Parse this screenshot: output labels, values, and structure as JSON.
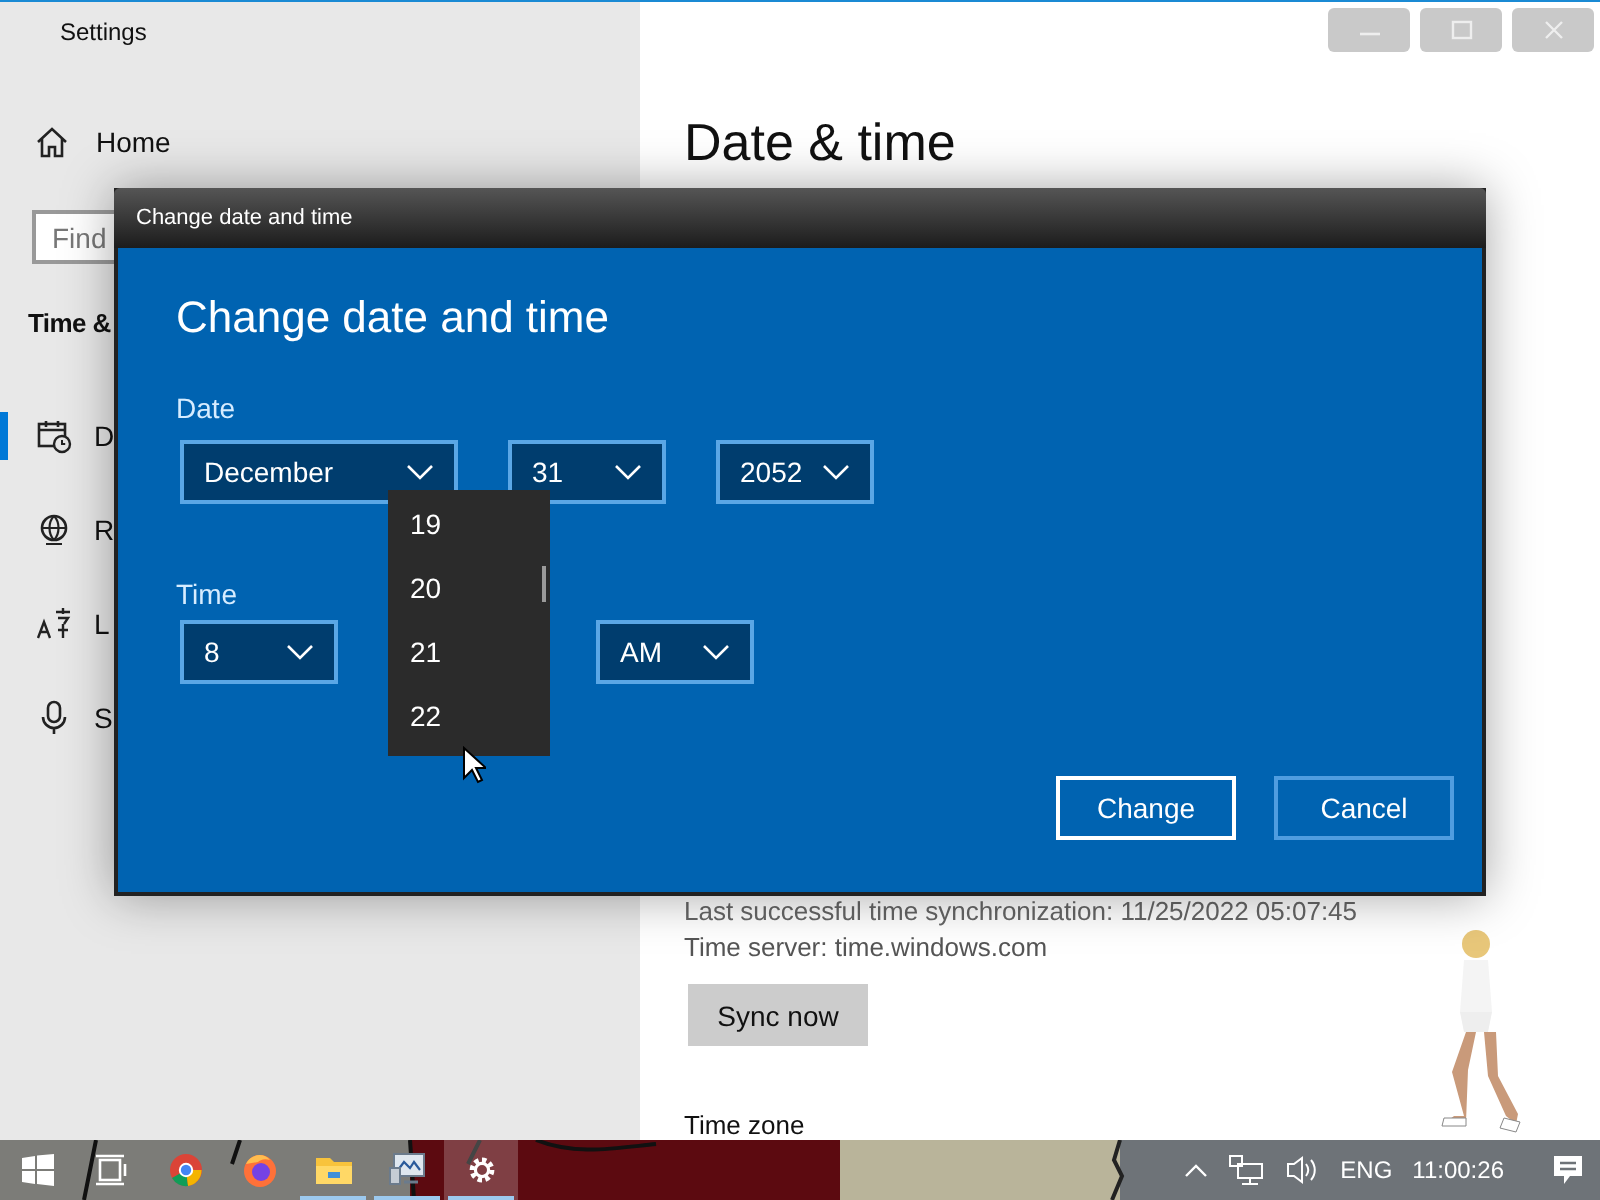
{
  "settings_window": {
    "title": "Settings",
    "window_controls": [
      {
        "kind": "minimize"
      },
      {
        "kind": "maximize"
      },
      {
        "kind": "close"
      }
    ]
  },
  "sidebar": {
    "home": "Home",
    "search_placeholder": "Find",
    "section": "Time &",
    "items": [
      {
        "kind": "calendar",
        "label": "D",
        "selected": true
      },
      {
        "kind": "globe",
        "label": "R",
        "selected": false
      },
      {
        "kind": "language",
        "label": "L",
        "selected": false
      },
      {
        "kind": "microphone",
        "label": "S",
        "selected": false
      }
    ]
  },
  "main": {
    "title": "Date & time",
    "sync_status": "Last successful time synchronization: 11/25/2022 05:07:45",
    "time_server": "Time server: time.windows.com",
    "sync_button": "Sync now",
    "time_zone_label": "Time zone"
  },
  "dialog": {
    "title": "Change date and time",
    "heading": "Change date and time",
    "date_label": "Date",
    "date_fields": [
      {
        "value": "December"
      },
      {
        "value": "31"
      },
      {
        "value": "2052"
      }
    ],
    "time_label": "Time",
    "time_fields": [
      {
        "value": "8"
      },
      {
        "value": "AM"
      }
    ],
    "dropdown": {
      "options": [
        {
          "label": "19"
        },
        {
          "label": "20"
        },
        {
          "label": "21"
        },
        {
          "label": "22"
        }
      ]
    },
    "buttons": [
      {
        "label": "Change",
        "focused": true
      },
      {
        "label": "Cancel",
        "focused": false
      }
    ]
  },
  "taskbar": {
    "apps": [
      {
        "kind": "start",
        "running": false,
        "active": false
      },
      {
        "kind": "task-view",
        "running": false,
        "active": false
      },
      {
        "kind": "chrome",
        "running": false,
        "active": false
      },
      {
        "kind": "firefox",
        "running": false,
        "active": false
      },
      {
        "kind": "folder",
        "running": true,
        "active": false
      },
      {
        "kind": "monitor",
        "running": true,
        "active": false
      },
      {
        "kind": "settings",
        "running": true,
        "active": true
      }
    ],
    "language": "ENG",
    "clock": "11:00:26"
  }
}
